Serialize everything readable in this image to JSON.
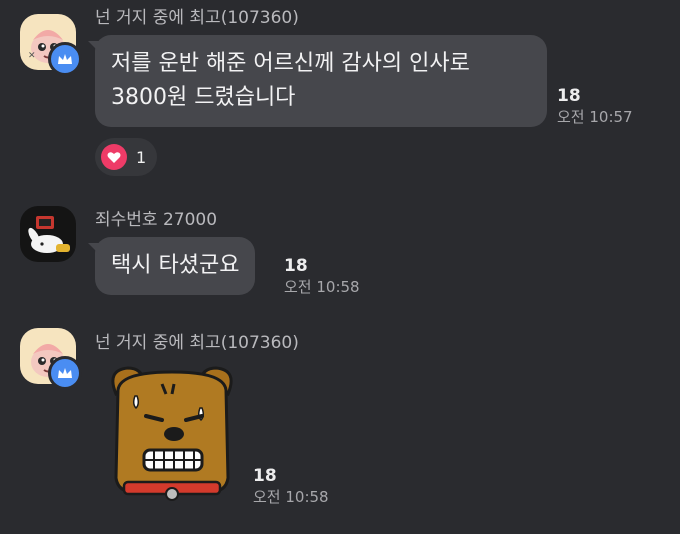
{
  "messages": [
    {
      "sender": "넌 거지 중에 최고(107360)",
      "text_lines": [
        "저를 운반 해준 어르신께 감사의 인사로",
        "3800원 드렸습니다"
      ],
      "unread": "18",
      "time": "오전 10:57",
      "reaction": {
        "icon": "heart-icon",
        "count": "1"
      }
    },
    {
      "sender": "죄수번호 27000",
      "text": "택시 타셨군요",
      "unread": "18",
      "time": "오전 10:58"
    },
    {
      "sender": "넌 거지 중에 최고(107360)",
      "sticker": "frowning-dog-sticker",
      "unread": "18",
      "time": "오전 10:58"
    }
  ],
  "colors": {
    "background": "#2a2b2f",
    "bubble": "#46474c",
    "crown_badge": "#4a8df2",
    "heart": "#ee3b67"
  }
}
